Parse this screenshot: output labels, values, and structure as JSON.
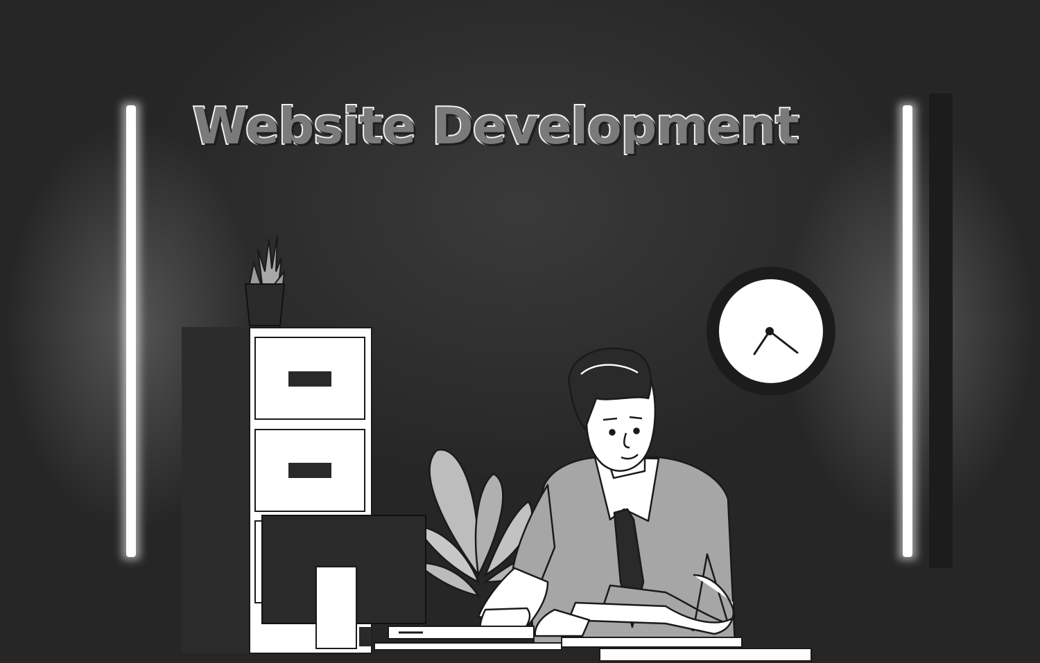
{
  "scene": {
    "headline": "Website Development"
  },
  "colors": {
    "wall": "#2a2a2a",
    "light_tube": "#ffffff",
    "outline": "#1a1a1a",
    "shirt": "#a6a6a6",
    "paper_white": "#ffffff"
  },
  "icons": [
    "wall-light-icon",
    "clock-icon",
    "plant-icon",
    "filing-cabinet-icon",
    "computer-monitor-icon",
    "office-worker-icon"
  ]
}
